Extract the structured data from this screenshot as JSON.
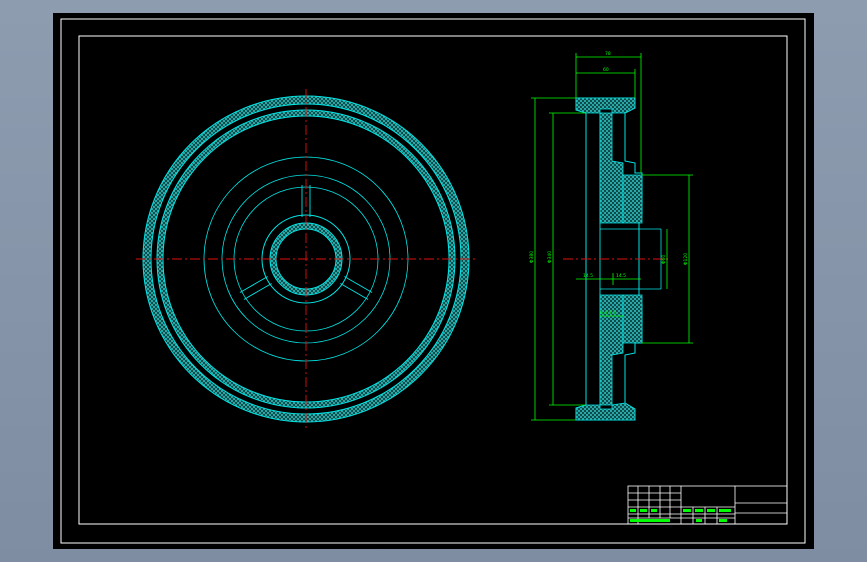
{
  "colors": {
    "background": "#000000",
    "border": "#ffffff",
    "outline": "#00e5e5",
    "centerline": "#e01010",
    "dimension": "#00ff00",
    "hatch": "#33cccc"
  },
  "views": {
    "front_view": "pulley front view",
    "section_view": "pulley section view"
  },
  "dimensions": {
    "top_overall": "78",
    "top_inner": "60",
    "diameter_outer": "Φ380",
    "diameter_rim": "Φ340",
    "diameter_hub": "Φ120",
    "diameter_bore": "Φ60",
    "web_left": "14.5",
    "web_right": "14.5",
    "small_note": "6.4 8 8"
  },
  "title_block": {
    "row_labels": [
      "",
      "",
      "",
      ""
    ],
    "bottom_labels": [
      "",
      "",
      "",
      ""
    ]
  }
}
